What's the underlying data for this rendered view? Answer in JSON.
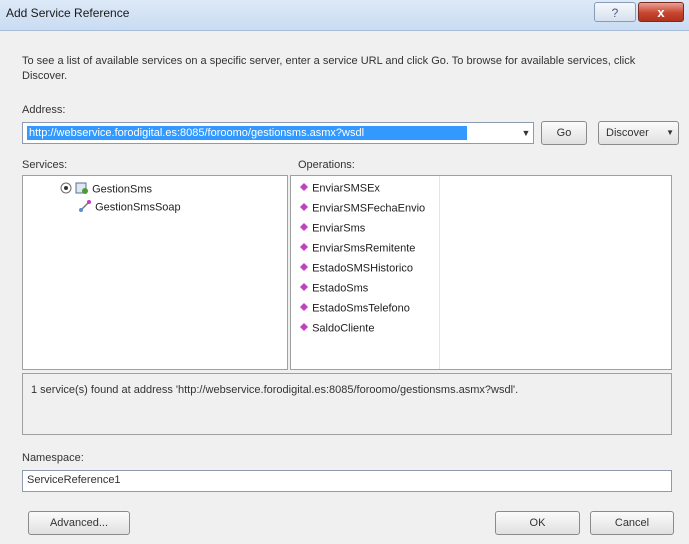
{
  "window": {
    "title": "Add Service Reference",
    "help_glyph": "?",
    "close_glyph": "x"
  },
  "instructions": "To see a list of available services on a specific server, enter a service URL and click Go. To browse for available services, click Discover.",
  "address": {
    "label": "Address:",
    "value": "http://webservice.forodigital.es:8085/foroomo/gestionsms.asmx?wsdl"
  },
  "buttons": {
    "go": "Go",
    "discover": "Discover",
    "advanced": "Advanced...",
    "ok": "OK",
    "cancel": "Cancel"
  },
  "services": {
    "label": "Services:",
    "items": [
      {
        "label": "GestionSms",
        "level": 0
      },
      {
        "label": "GestionSmsSoap",
        "level": 1
      }
    ]
  },
  "operations": {
    "label": "Operations:",
    "items": [
      "EnviarSMSEx",
      "EnviarSMSFechaEnvio",
      "EnviarSms",
      "EnviarSmsRemitente",
      "EstadoSMSHistorico",
      "EstadoSms",
      "EstadoSmsTelefono",
      "SaldoCliente"
    ]
  },
  "status_text": "1 service(s) found at address 'http://webservice.forodigital.es:8085/foroomo/gestionsms.asmx?wsdl'.",
  "namespace": {
    "label": "Namespace:",
    "value": "ServiceReference1"
  },
  "colors": {
    "selection": "#3399ff",
    "operation_icon": "#c040c0",
    "close_button": "#c8452f"
  }
}
